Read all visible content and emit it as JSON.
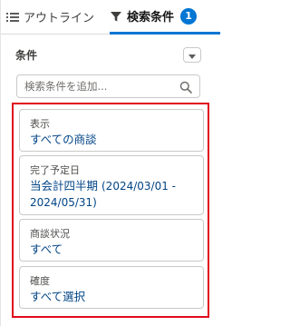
{
  "tabs": {
    "outline_label": "アウトライン",
    "search_label": "検索条件",
    "search_count": "1"
  },
  "conditions": {
    "title": "条件",
    "search_placeholder": "検索条件を追加..."
  },
  "filters": [
    {
      "label": "表示",
      "value": "すべての商談"
    },
    {
      "label": "完了予定日",
      "value": "当会計四半期",
      "value_detail": "(2024/03/01 - 2024/05/31)"
    },
    {
      "label": "商談状況",
      "value": "すべて"
    },
    {
      "label": "確度",
      "value": "すべて選択"
    }
  ],
  "colors": {
    "accent": "#0176d3",
    "link": "#014486",
    "highlight_border": "#e0091c"
  },
  "icons": {
    "outline_tab": "list-icon",
    "search_tab": "funnel-icon",
    "menu": "chevron-down-icon",
    "search": "search-icon"
  }
}
